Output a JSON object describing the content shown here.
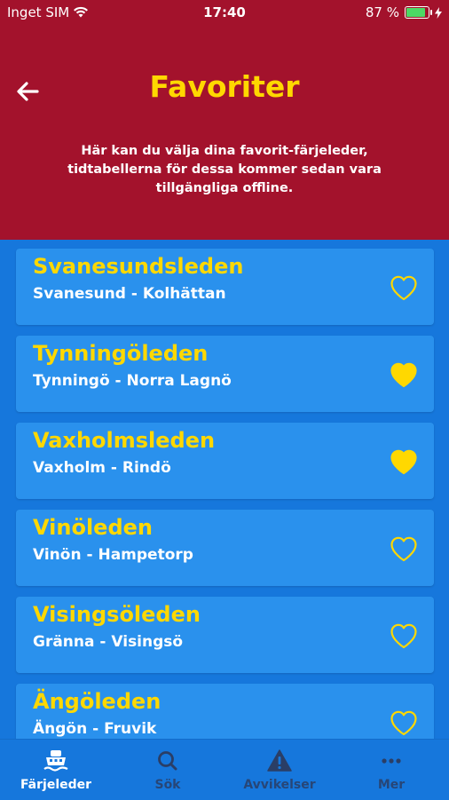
{
  "statusbar": {
    "carrier": "Inget SIM",
    "time": "17:40",
    "battery_text": "87 %",
    "battery_level": 0.87
  },
  "header": {
    "title": "Favoriter",
    "description": "Här kan du välja dina favorit-färjeleder, tidtabellerna för dessa kommer sedan vara tillgängliga offline.",
    "back_icon": "arrow-left-icon"
  },
  "colors": {
    "header_bg": "#a3122c",
    "title": "#ffd800",
    "list_bg": "#1677dc",
    "card_bg": "#2a91ed",
    "heart": "#ffd800"
  },
  "routes": [
    {
      "name": "Svanesundsleden",
      "route": "Svanesund - Kolhättan",
      "favorite": false
    },
    {
      "name": "Tynningöleden",
      "route": "Tynningö - Norra Lagnö",
      "favorite": true
    },
    {
      "name": "Vaxholmsleden",
      "route": "Vaxholm - Rindö",
      "favorite": true
    },
    {
      "name": "Vinöleden",
      "route": "Vinön - Hampetorp",
      "favorite": false
    },
    {
      "name": "Visingsöleden",
      "route": "Gränna - Visingsö",
      "favorite": false
    },
    {
      "name": "Ängöleden",
      "route": "Ängön - Fruvik",
      "favorite": false
    }
  ],
  "tabs": [
    {
      "label": "Färjeleder",
      "icon": "ferry-icon",
      "active": true
    },
    {
      "label": "Sök",
      "icon": "search-icon",
      "active": false
    },
    {
      "label": "Avvikelser",
      "icon": "warning-icon",
      "active": false
    },
    {
      "label": "Mer",
      "icon": "more-icon",
      "active": false
    }
  ]
}
